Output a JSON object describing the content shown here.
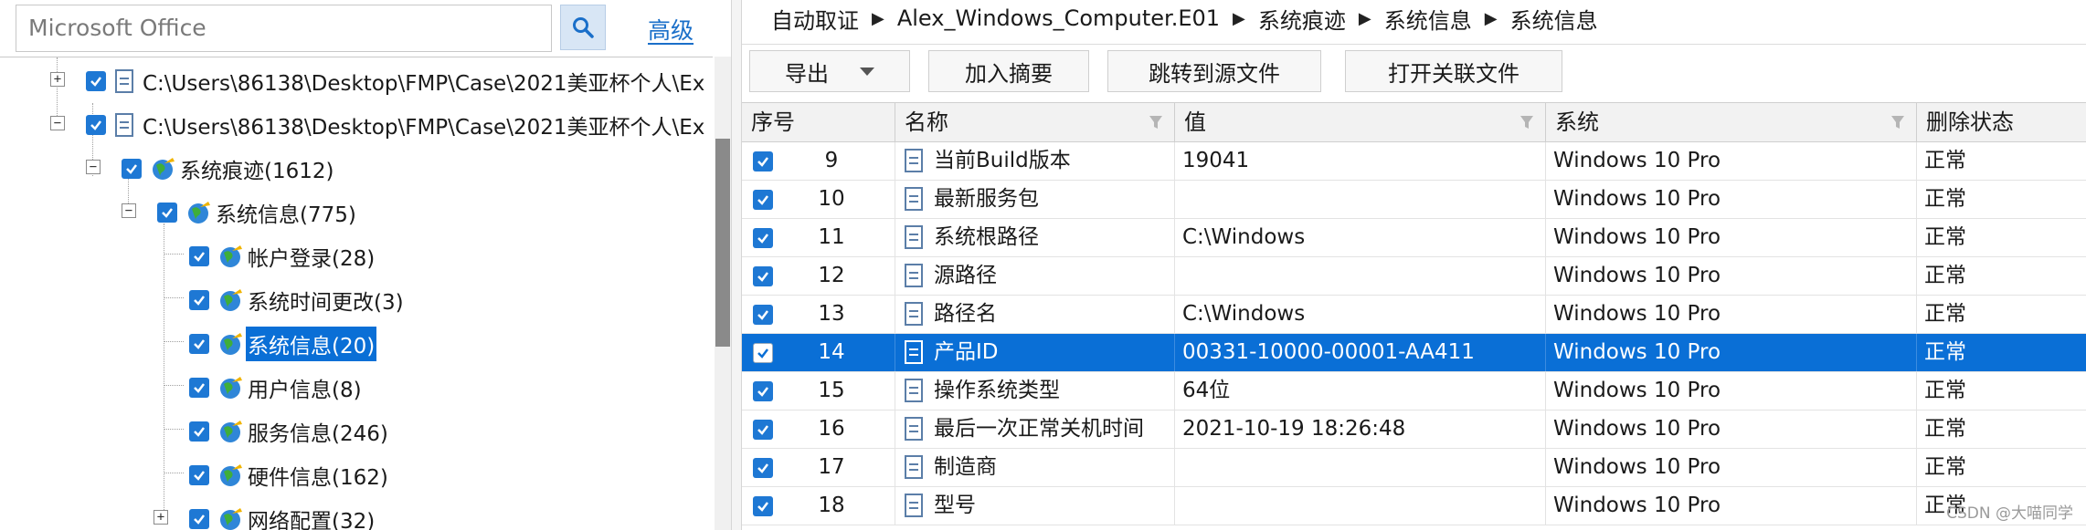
{
  "search": {
    "value": "Microsoft Office",
    "advanced_label": "高级"
  },
  "tree": {
    "nodes": [
      {
        "label": "C:\\Users\\86138\\Desktop\\FMP\\Case\\2021美亚杯个人\\Ex",
        "expander": "+"
      },
      {
        "label": "C:\\Users\\86138\\Desktop\\FMP\\Case\\2021美亚杯个人\\Ex",
        "expander": "−"
      },
      {
        "label": "系统痕迹(1612)",
        "expander": "−"
      },
      {
        "label": "系统信息(775)",
        "expander": "−"
      },
      {
        "label": "帐户登录(28)"
      },
      {
        "label": "系统时间更改(3)"
      },
      {
        "label": "系统信息(20)"
      },
      {
        "label": "用户信息(8)"
      },
      {
        "label": "服务信息(246)"
      },
      {
        "label": "硬件信息(162)"
      },
      {
        "label": "网络配置(32)",
        "expander": "+"
      }
    ]
  },
  "breadcrumb": [
    "自动取证",
    "Alex_Windows_Computer.E01",
    "系统痕迹",
    "系统信息",
    "系统信息"
  ],
  "toolbar": {
    "export": "导出",
    "add_summary": "加入摘要",
    "jump_source": "跳转到源文件",
    "open_related": "打开关联文件"
  },
  "table": {
    "columns": [
      "序号",
      "名称",
      "值",
      "系统",
      "删除状态"
    ],
    "rows": [
      {
        "no": "9",
        "name": "当前Build版本",
        "value": "19041",
        "system": "Windows 10 Pro",
        "status": "正常"
      },
      {
        "no": "10",
        "name": "最新服务包",
        "value": "",
        "system": "Windows 10 Pro",
        "status": "正常"
      },
      {
        "no": "11",
        "name": "系统根路径",
        "value": "C:\\Windows",
        "system": "Windows 10 Pro",
        "status": "正常"
      },
      {
        "no": "12",
        "name": "源路径",
        "value": "",
        "system": "Windows 10 Pro",
        "status": "正常"
      },
      {
        "no": "13",
        "name": "路径名",
        "value": "C:\\Windows",
        "system": "Windows 10 Pro",
        "status": "正常"
      },
      {
        "no": "14",
        "name": "产品ID",
        "value": "00331-10000-00001-AA411",
        "system": "Windows 10 Pro",
        "status": "正常",
        "selected": true
      },
      {
        "no": "15",
        "name": "操作系统类型",
        "value": "64位",
        "system": "Windows 10 Pro",
        "status": "正常"
      },
      {
        "no": "16",
        "name": "最后一次正常关机时间",
        "value": "2021-10-19 18:26:48",
        "system": "Windows 10 Pro",
        "status": "正常"
      },
      {
        "no": "17",
        "name": "制造商",
        "value": "",
        "system": "Windows 10 Pro",
        "status": "正常"
      },
      {
        "no": "18",
        "name": "型号",
        "value": "",
        "system": "Windows 10 Pro",
        "status": "正常"
      }
    ]
  },
  "watermark": "CSDN @大喵同学",
  "colors": {
    "accent": "#0a6fd6",
    "checkbox": "#1e78d4",
    "link": "#1a6fc9"
  },
  "icons": [
    "search-icon",
    "checkbox-icon",
    "file-icon",
    "globe-icon",
    "filter-icon",
    "dropdown-caret-icon",
    "breadcrumb-arrow-icon"
  ]
}
